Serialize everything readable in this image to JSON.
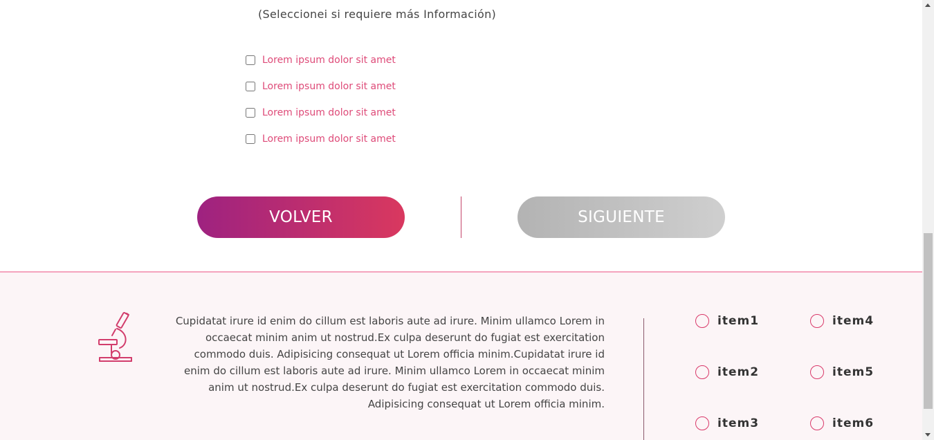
{
  "form": {
    "subtitle": "(Seleccionei si requiere más Información)",
    "options": [
      {
        "label": "Lorem ipsum dolor sit amet",
        "checked": false
      },
      {
        "label": "Lorem ipsum dolor sit amet",
        "checked": false
      },
      {
        "label": "Lorem ipsum dolor sit amet",
        "checked": false
      },
      {
        "label": "Lorem ipsum dolor sit amet",
        "checked": false
      }
    ]
  },
  "navigation": {
    "back_label": "VOLVER",
    "next_label": "SIGUIENTE"
  },
  "footer": {
    "icon": "microscope-icon",
    "text": "Cupidatat irure id enim do cillum est laboris aute ad irure. Minim ullamco Lorem in occaecat minim anim ut nostrud.Ex culpa deserunt do fugiat est exercitation commodo duis. Adipisicing consequat ut Lorem officia minim.Cupidatat irure id enim do cillum est laboris aute ad irure. Minim ullamco Lorem in occaecat minim anim ut nostrud.Ex culpa deserunt do fugiat est exercitation commodo duis. Adipisicing consequat ut Lorem officia minim.",
    "items": [
      {
        "label": "item1"
      },
      {
        "label": "item2"
      },
      {
        "label": "item3"
      },
      {
        "label": "item4"
      },
      {
        "label": "item5"
      },
      {
        "label": "item6"
      }
    ]
  },
  "colors": {
    "accent": "#d9396a",
    "back_gradient": [
      "#9e2280",
      "#d9385f"
    ],
    "next_gradient": [
      "#b3b3b3",
      "#cfcfcf"
    ],
    "footer_background": "#fcf5f7"
  }
}
